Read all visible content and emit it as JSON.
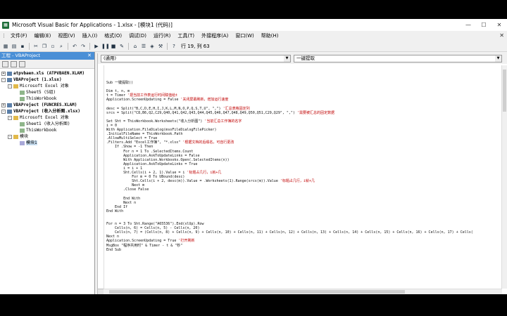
{
  "window": {
    "title": "Microsoft Visual Basic for Applications - 1.xlsx - [模块1 (代码)]",
    "controls": [
      "—",
      "☐",
      "✕"
    ]
  },
  "menubar": {
    "items": [
      "文件(F)",
      "编辑(E)",
      "视图(V)",
      "插入(I)",
      "格式(O)",
      "调试(D)",
      "运行(R)",
      "工具(T)",
      "外接程序(A)",
      "窗口(W)",
      "帮助(H)"
    ]
  },
  "toolbar": {
    "position_text": "行 19, 列 63"
  },
  "project_panel": {
    "title": "工程 - VBAProject",
    "close": "✕",
    "tree": [
      {
        "label": "atpvbaen.xls (ATPVBAEN.XLAM)",
        "level": 0,
        "toggle": "+",
        "icon": "proj",
        "bold": true
      },
      {
        "label": "VBAProject (1.xlsx)",
        "level": 0,
        "toggle": "-",
        "icon": "proj",
        "bold": true
      },
      {
        "label": "Microsoft Excel 对象",
        "level": 1,
        "toggle": "-",
        "icon": "folder",
        "bold": false
      },
      {
        "label": "Sheet5 (5组)",
        "level": 2,
        "toggle": "",
        "icon": "sheet",
        "bold": false
      },
      {
        "label": "ThisWorkbook",
        "level": 2,
        "toggle": "",
        "icon": "sheet",
        "bold": false
      },
      {
        "label": "VBAProject (FUNCRES.XLAM)",
        "level": 0,
        "toggle": "+",
        "icon": "proj",
        "bold": true
      },
      {
        "label": "VBAProject (收入分析图.xlsx)",
        "level": 0,
        "toggle": "-",
        "icon": "proj",
        "bold": true
      },
      {
        "label": "Microsoft Excel 对象",
        "level": 1,
        "toggle": "-",
        "icon": "folder",
        "bold": false
      },
      {
        "label": "Sheet1 (收入分析图)",
        "level": 2,
        "toggle": "",
        "icon": "sheet",
        "bold": false
      },
      {
        "label": "ThisWorkbook",
        "level": 2,
        "toggle": "",
        "icon": "sheet",
        "bold": false
      },
      {
        "label": "模块",
        "level": 1,
        "toggle": "-",
        "icon": "folder",
        "bold": false
      },
      {
        "label": "模块1",
        "level": 2,
        "toggle": "",
        "icon": "module",
        "bold": false,
        "selected": true
      }
    ]
  },
  "editor": {
    "object_dropdown": "(通用)",
    "proc_dropdown": "一键提取",
    "code_lines": [
      {
        "code": "Sub 一键提取()",
        "comment": ""
      },
      {
        "code": "",
        "comment": ""
      },
      {
        "code": "Dim t, n, m",
        "comment": ""
      },
      {
        "code": "t = Timer ",
        "comment": "'把当前工作表运行时间赋值给t"
      },
      {
        "code": "Application.ScreenUpdating = False ",
        "comment": "'关闭屏幕刷新，增加运行速度"
      },
      {
        "code": "",
        "comment": ""
      },
      {
        "code": "desc = Split(\"B,C,D,E,H,I,J,K,L,M,N,O,P,Q,S,T,U\", \",\") ",
        "comment": "'汇总表格固定列"
      },
      {
        "code": "srcs = Split(\"C8,B6,Q2,C29,Q40,Q41,Q42,Q43,Q44,Q45,Q46,Q47,Q48,Q49,Q50,Q51,C29,Q29\", \",\") ",
        "comment": "'需要被汇总的固定数据"
      },
      {
        "code": "",
        "comment": ""
      },
      {
        "code": "Set Sht = ThisWorkbook.Worksheets(\"收入分析图\") ",
        "comment": "'当前汇总工作簿的名字"
      },
      {
        "code": "i = 0",
        "comment": ""
      },
      {
        "code": "With Application.FileDialog(msoFileDialogFilePicker)",
        "comment": ""
      },
      {
        "code": ".InitialFileName = ThisWorkbook.Path",
        "comment": ""
      },
      {
        "code": ".AllowMultiSelect = True",
        "comment": ""
      },
      {
        "code": ".Filters.Add \"Excel工作簿\", \"*.xlsx\" ",
        "comment": "'根据文档的后缀名，可自行更改"
      },
      {
        "code": "    If .Show = -1 Then",
        "comment": ""
      },
      {
        "code": "        For n = 1 To .SelectedItems.Count",
        "comment": ""
      },
      {
        "code": "        Application.AskToUpdateLinks = False",
        "comment": ""
      },
      {
        "code": "        With Application.Workbooks.Open(.SelectedItems(n))",
        "comment": ""
      },
      {
        "code": "        Application.AskToUpdateLinks = True",
        "comment": ""
      },
      {
        "code": "        i = i + 1",
        "comment": ""
      },
      {
        "code": "        Sht.Cells(i + 2, 1).Value = i ",
        "comment": "'标题占几行，i就+几"
      },
      {
        "code": "            For m = 0 To UBound(desc)",
        "comment": ""
      },
      {
        "code": "            Sht.Cells(i + 2, desc(m)).Value = .Worksheets(1).Range(srcs(m)).Value ",
        "comment": "'标题占几行，i就+几"
      },
      {
        "code": "            Next m",
        "comment": ""
      },
      {
        "code": "        .Close False",
        "comment": ""
      },
      {
        "code": "",
        "comment": ""
      },
      {
        "code": "        End With",
        "comment": ""
      },
      {
        "code": "        Next n",
        "comment": ""
      },
      {
        "code": "    End If",
        "comment": ""
      },
      {
        "code": "End With",
        "comment": ""
      },
      {
        "code": "",
        "comment": ""
      },
      {
        "code": "",
        "comment": ""
      },
      {
        "code": "For n = 3 To Sht.Range(\"A65536\").End(xlUp).Row",
        "comment": ""
      },
      {
        "code": "    Cells(n, 6) = Cells(n, 5) - Cells(n, 20)",
        "comment": ""
      },
      {
        "code": "    Cells(n, 7) = (Cells(n, 8) + Cells(n, 9) + Cells(n, 10) + Cells(n, 11) + Cells(n, 12) + Cells(n, 13) + Cells(n, 14) + Cells(n, 15) + Cells(n, 16) + Cells(n, 17) + Cells(",
        "comment": ""
      },
      {
        "code": "Next n",
        "comment": ""
      },
      {
        "code": "Application.ScreenUpdating = True ",
        "comment": "'打开刷新"
      },
      {
        "code": "MsgBox \"程序共用时\" & Timer - t & \"秒\"",
        "comment": ""
      },
      {
        "code": "End Sub",
        "comment": ""
      }
    ]
  }
}
